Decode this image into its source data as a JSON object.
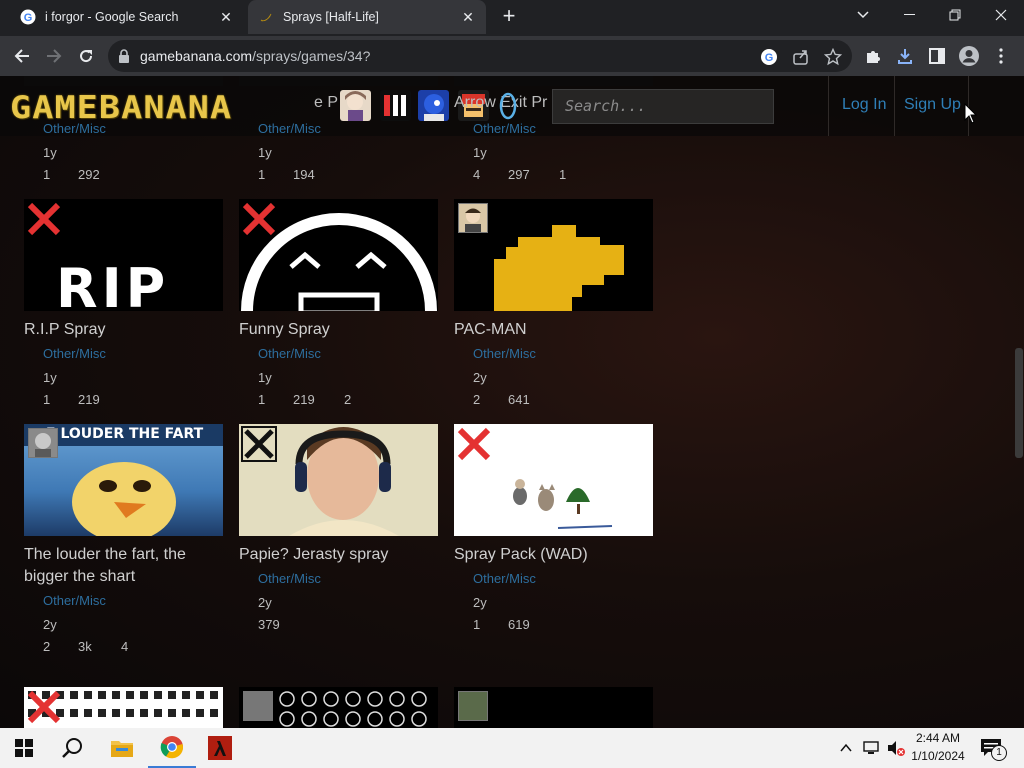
{
  "browser": {
    "tabs": [
      {
        "title": "i forgor - Google Search",
        "favicon": "google-icon"
      },
      {
        "title": "Sprays [Half-Life]",
        "favicon": "banana-icon"
      }
    ],
    "url_host": "gamebanana.com",
    "url_path": "/sprays/games/34?"
  },
  "site": {
    "logo_text": "GAMEBANANA",
    "header_text_1": "e P",
    "header_text_2": "Arrow Exit Pr",
    "search_placeholder": "Search...",
    "login": "Log In",
    "signup": "Sign Up"
  },
  "row0": [
    {
      "category": "Other/Misc",
      "age": "1y",
      "stats": [
        "1",
        "292"
      ]
    },
    {
      "category": "Other/Misc",
      "age": "1y",
      "stats": [
        "1",
        "194"
      ]
    },
    {
      "category": "Other/Misc",
      "age": "1y",
      "stats": [
        "4",
        "297",
        "1"
      ]
    }
  ],
  "row1": [
    {
      "title": "R.I.P Spray",
      "category": "Other/Misc",
      "age": "1y",
      "stats": [
        "1",
        "219"
      ],
      "thumb_text": "RIP"
    },
    {
      "title": "Funny Spray",
      "category": "Other/Misc",
      "age": "1y",
      "stats": [
        "1",
        "219",
        "2"
      ]
    },
    {
      "title": "PAC-MAN",
      "category": "Other/Misc",
      "age": "2y",
      "stats": [
        "2",
        "641"
      ]
    }
  ],
  "row2": [
    {
      "title_line1": "The louder the fart, the",
      "title_line2": "bigger the shart",
      "category": "Other/Misc",
      "age": "2y",
      "stats": [
        "2",
        "3k",
        "4"
      ],
      "thumb_text": "E LOUDER THE FART"
    },
    {
      "title": "Papie? Jerasty spray",
      "category": "Other/Misc",
      "age": "2y",
      "stats": [
        "379"
      ]
    },
    {
      "title": "Spray Pack (WAD)",
      "category": "Other/Misc",
      "age": "2y",
      "stats": [
        "1",
        "619"
      ]
    }
  ],
  "taskbar": {
    "time": "2:44 AM",
    "date": "1/10/2024",
    "notification_count": "1"
  },
  "colors": {
    "link_blue": "#2d6e9e",
    "logo_gold": "#e8c64a",
    "red_x": "#e43232"
  }
}
